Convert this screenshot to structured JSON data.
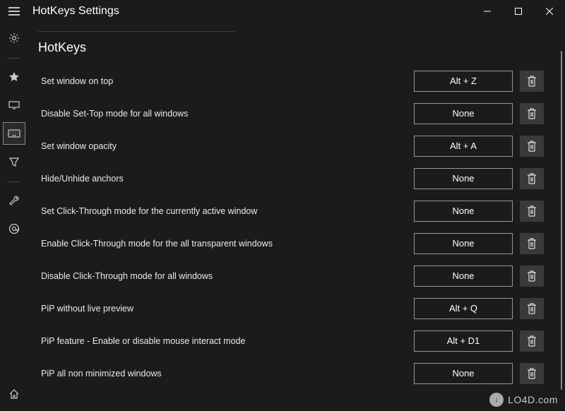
{
  "window": {
    "title": "HotKeys Settings"
  },
  "section": {
    "title": "HotKeys"
  },
  "hotkeys": [
    {
      "label": "Set window on top",
      "value": "Alt + Z"
    },
    {
      "label": "Disable Set-Top mode for all windows",
      "value": "None"
    },
    {
      "label": "Set window opacity",
      "value": "Alt + A"
    },
    {
      "label": "Hide/Unhide anchors",
      "value": "None"
    },
    {
      "label": "Set Click-Through mode for the currently active window",
      "value": "None"
    },
    {
      "label": "Enable Click-Through mode for the all transparent windows",
      "value": "None"
    },
    {
      "label": "Disable Click-Through mode for all windows",
      "value": "None"
    },
    {
      "label": "PiP without live preview",
      "value": "Alt + Q"
    },
    {
      "label": "PiP feature - Enable or disable mouse interact mode",
      "value": "Alt + D1"
    },
    {
      "label": "PiP all non minimized windows",
      "value": "None"
    }
  ],
  "watermark": {
    "bubble": "↓",
    "text": "LO4D.com"
  }
}
